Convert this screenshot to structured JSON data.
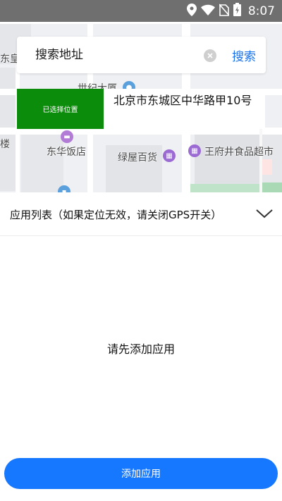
{
  "status_bar": {
    "time": "8:07",
    "icons": [
      "location-icon",
      "wifi-icon",
      "no-sim-icon",
      "battery-charging-icon"
    ]
  },
  "map": {
    "labels": {
      "dong_huang": "东皇",
      "century_tower": "世纪大厦",
      "dong_hua_hotel": "东华饭店",
      "lv_wu_dept": "绿屋百货",
      "wangfujing_food": "王府井食品超市",
      "lou": "楼"
    }
  },
  "search": {
    "placeholder": "搜索地址",
    "button_label": "搜索"
  },
  "location": {
    "badge_label": "已选择位置",
    "address": "北京市东城区中华路甲10号"
  },
  "app_list": {
    "header": "应用列表（如果定位无效，请关闭GPS开关）",
    "empty_text": "请先添加应用",
    "add_button_label": "添加应用"
  },
  "colors": {
    "accent": "#1677ff",
    "search_blue": "#1a73e8",
    "selected_badge": "#0b8c0b",
    "status_bar": "#6f6f6f"
  }
}
